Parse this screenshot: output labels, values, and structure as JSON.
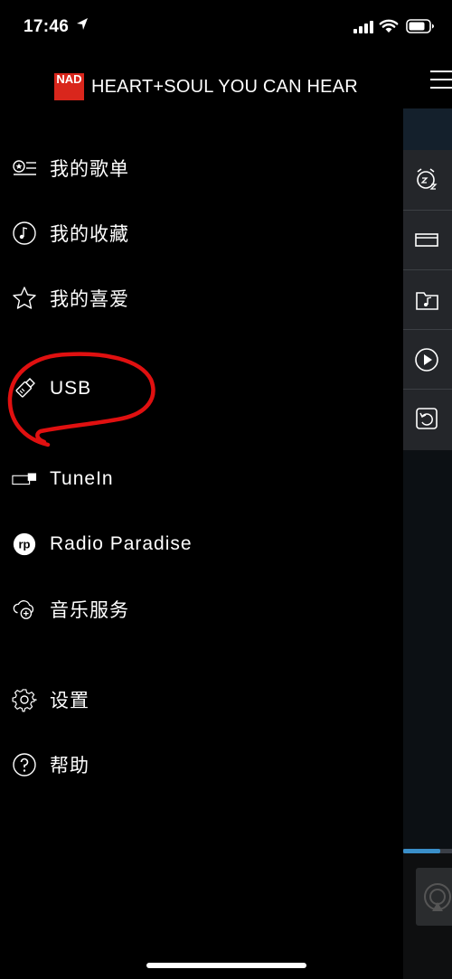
{
  "status": {
    "time": "17:46"
  },
  "brand": {
    "logo_text": "NAD",
    "tagline": "HEART+SOUL YOU CAN HEAR",
    "logo_color": "#d9261c"
  },
  "menu": {
    "items": [
      {
        "label": "我的歌单",
        "icon": "playlist-icon"
      },
      {
        "label": "我的收藏",
        "icon": "music-note-circle-icon"
      },
      {
        "label": "我的喜爱",
        "icon": "star-icon"
      },
      {
        "label": "USB",
        "icon": "usb-stick-icon"
      },
      {
        "label": "TuneIn",
        "icon": "tunein-icon"
      },
      {
        "label": "Radio Paradise",
        "icon": "radio-paradise-icon"
      },
      {
        "label": "音乐服务",
        "icon": "cloud-add-icon"
      },
      {
        "label": "设置",
        "icon": "gear-icon"
      },
      {
        "label": "帮助",
        "icon": "help-icon"
      }
    ],
    "tunein_badge": "TUNE IN",
    "rp_badge": "rp"
  },
  "quick_strip": [
    {
      "icon": "sleep-timer-icon"
    },
    {
      "icon": "device-icon"
    },
    {
      "icon": "music-folder-icon"
    },
    {
      "icon": "play-icon"
    },
    {
      "icon": "repeat-icon"
    }
  ],
  "playback": {
    "progress": 0.75
  },
  "colors": {
    "accent": "#3a8fc9",
    "annotation": "#e01010"
  }
}
